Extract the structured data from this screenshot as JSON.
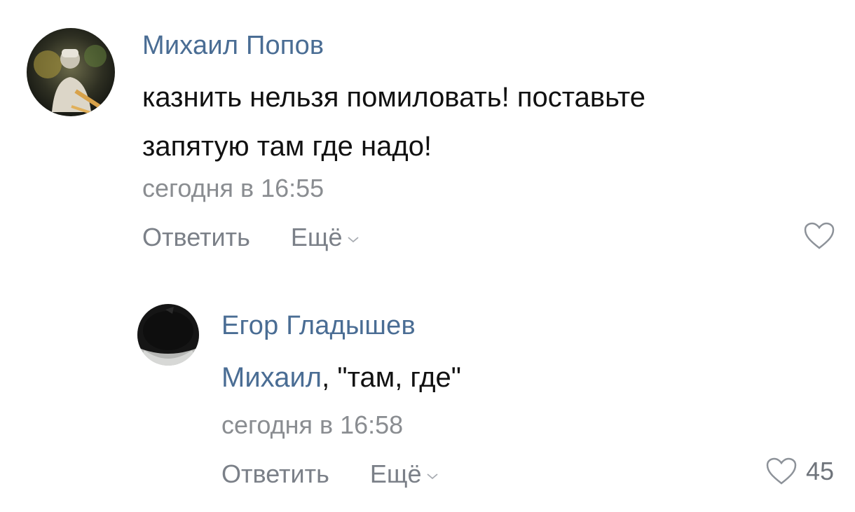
{
  "comments": [
    {
      "author": "Михаил Попов",
      "text_lines": [
        "казнить нельзя помиловать! поставьте",
        "запятую там где надо!"
      ],
      "time": "сегодня в 16:55",
      "reply_label": "Ответить",
      "more_label": "Ещё",
      "likes": ""
    },
    {
      "author": "Егор Гладышев",
      "mention": "Михаил",
      "text": ", \"там, где\"",
      "time": "сегодня в 16:58",
      "reply_label": "Ответить",
      "more_label": "Ещё",
      "likes": "45"
    }
  ],
  "icons": {
    "heart": "heart-icon",
    "chevron": "chevron-down-icon"
  },
  "colors": {
    "author": "#4a6d94",
    "text": "#111111",
    "meta": "#8a8d91",
    "action": "#7b8088"
  }
}
